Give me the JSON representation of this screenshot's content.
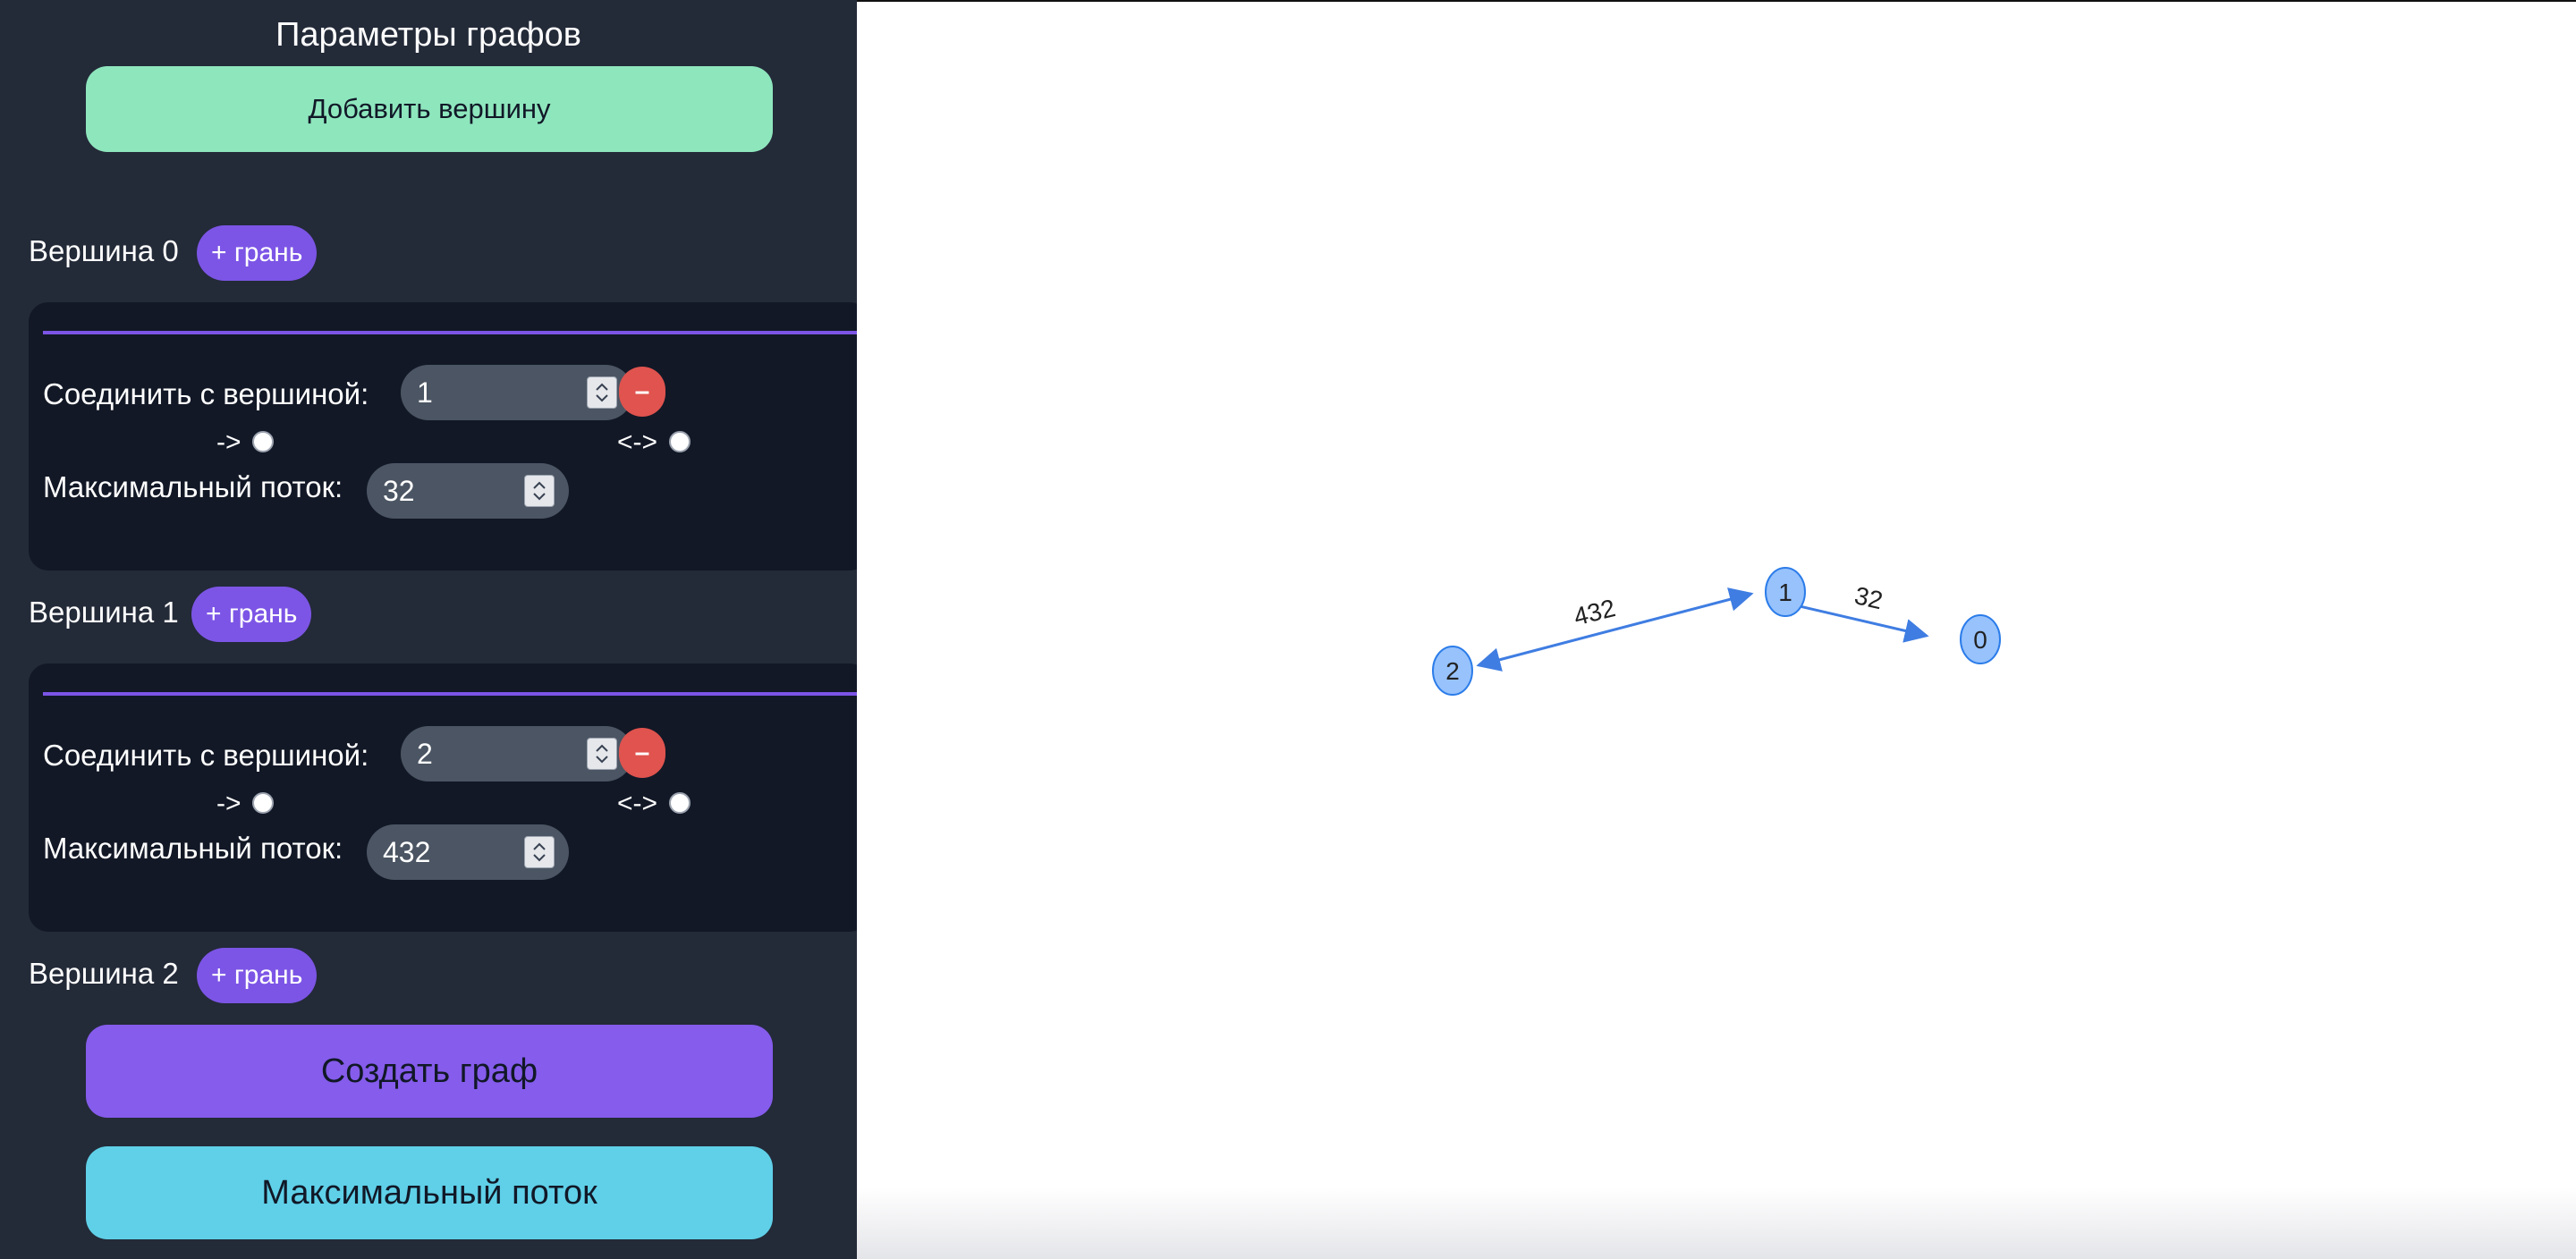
{
  "sidebar": {
    "title": "Параметры графов",
    "add_vertex_label": "Добавить вершину",
    "create_graph_label": "Создать граф",
    "max_flow_label": "Максимальный поток",
    "add_edge_label": "+ грань",
    "connect_label": "Соединить с вершиной:",
    "max_flow_field_label": "Максимальный поток:",
    "directed_label": "->",
    "bidirectional_label": "<->",
    "remove_label": "–",
    "vertices": [
      {
        "label": "Вершина 0",
        "edge": {
          "target": "1",
          "capacity": "32"
        }
      },
      {
        "label": "Вершина 1",
        "edge": {
          "target": "2",
          "capacity": "432"
        }
      },
      {
        "label": "Вершина 2"
      }
    ]
  },
  "graph": {
    "nodes": [
      "0",
      "1",
      "2"
    ],
    "edges": [
      {
        "from": "0",
        "to": "1",
        "label": "32",
        "bidirectional": true
      },
      {
        "from": "1",
        "to": "2",
        "label": "432",
        "bidirectional": true
      }
    ],
    "node_fill": "#97c2fc",
    "node_border": "#2b7ce9",
    "edge_color": "#3f7de2"
  }
}
